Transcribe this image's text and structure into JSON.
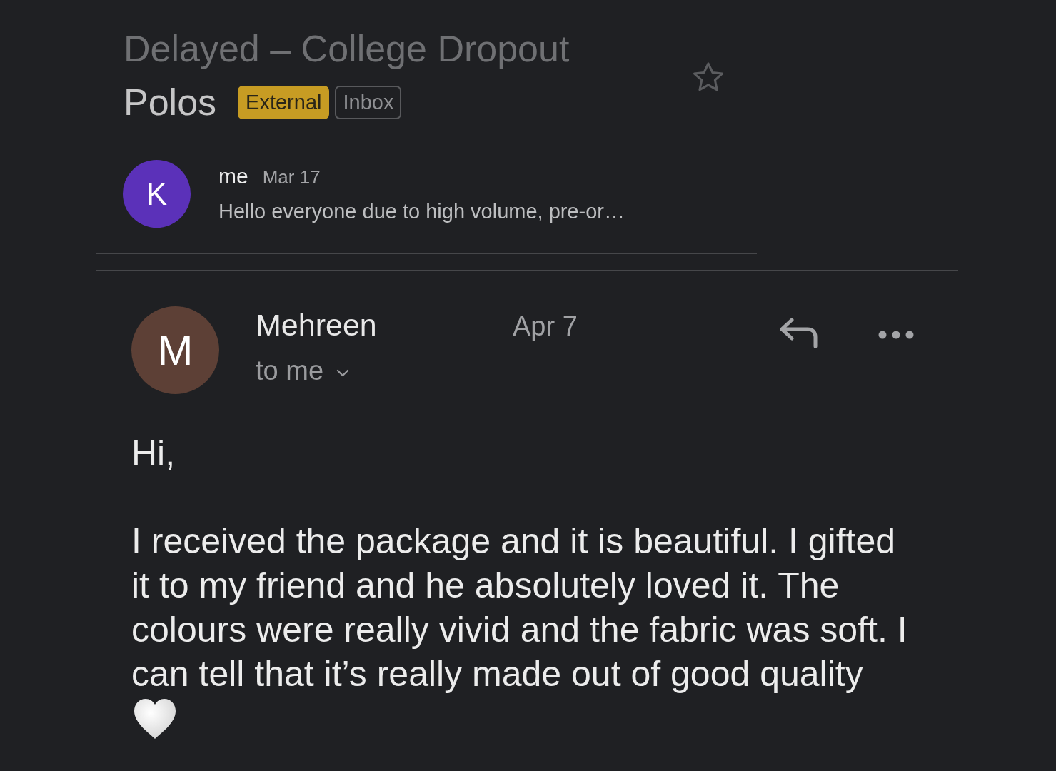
{
  "subject": {
    "title_lines": [
      "Delayed – College Dropout",
      "Polos"
    ],
    "labels": [
      {
        "text": "External",
        "kind": "external"
      },
      {
        "text": "Inbox",
        "kind": "folder"
      }
    ],
    "starred": false
  },
  "thread": [
    {
      "kind": "collapsed",
      "avatar_letter": "K",
      "color": "#5b31b9",
      "sender": "me",
      "date": "Mar 17",
      "snippet": "Hello everyone due to high volume, pre-or…"
    },
    {
      "kind": "expanded",
      "avatar_letter": "M",
      "color": "#5d4036",
      "sender": "Mehreen",
      "date": "Apr 7",
      "recipients": "to me",
      "greeting": "Hi,",
      "body": "I received the package and it is beautiful. I gifted it to my friend and he absolutely loved it. The colours were really vivid and the fabric was soft. I can tell that it’s really made out of good quality"
    }
  ]
}
